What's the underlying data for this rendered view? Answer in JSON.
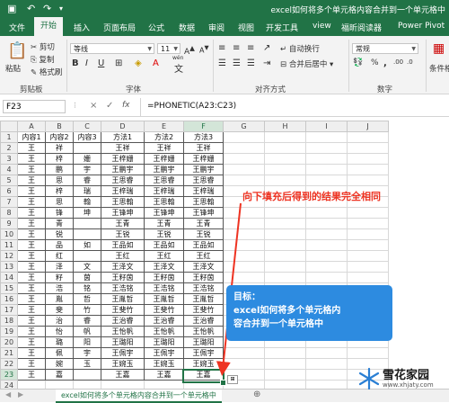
{
  "window": {
    "title": "excel如何将多个单元格内容合并到一个单元格中",
    "autosave_icon": "save-icon",
    "undo_icon": "undo-icon",
    "redo_icon": "redo-icon"
  },
  "tabs": [
    "文件",
    "开始",
    "插入",
    "页面布局",
    "公式",
    "数据",
    "审阅",
    "视图",
    "开发工具",
    "view",
    "福昕阅读器",
    "Power Pivot"
  ],
  "active_tab": "开始",
  "ribbon": {
    "clipboard": {
      "paste": "粘贴",
      "cut": "剪切",
      "copy": "复制",
      "format_painter": "格式刷",
      "group": "剪贴板"
    },
    "font": {
      "name": "等线",
      "size": "11",
      "bold": "B",
      "italic": "I",
      "underline": "U",
      "group": "字体",
      "wen": "wén"
    },
    "alignment": {
      "wrap": "自动换行",
      "merge": "合并后居中",
      "group": "对齐方式"
    },
    "number": {
      "format": "常规",
      "percent": "%",
      "comma": ",",
      "group": "数字"
    },
    "styles": {
      "conditional": "条件格式"
    }
  },
  "formula_bar": {
    "name_box": "F23",
    "cancel": "×",
    "confirm": "✓",
    "fx": "fx",
    "formula": "=PHONETIC(A23:C23)"
  },
  "sheet": {
    "columns": [
      "A",
      "B",
      "C",
      "D",
      "E",
      "F",
      "G",
      "H",
      "I",
      "J"
    ],
    "selected_col": "F",
    "selected_row": 23,
    "rows": [
      [
        "内容1",
        "内容2",
        "内容3",
        "方法1",
        "方法2",
        "方法3"
      ],
      [
        "王",
        "祥",
        "",
        "王祥",
        "王祥",
        "王祥"
      ],
      [
        "王",
        "梓",
        "姗",
        "王梓姗",
        "王梓姗",
        "王梓姗"
      ],
      [
        "王",
        "鹏",
        "宇",
        "王鹏宇",
        "王鹏宇",
        "王鹏宇"
      ],
      [
        "王",
        "思",
        "睿",
        "王思睿",
        "王思睿",
        "王思睿"
      ],
      [
        "王",
        "梓",
        "瑞",
        "王梓瑞",
        "王梓瑞",
        "王梓瑞"
      ],
      [
        "王",
        "思",
        "翰",
        "王思翰",
        "王思翰",
        "王思翰"
      ],
      [
        "王",
        "锋",
        "坤",
        "王锋坤",
        "王锋坤",
        "王锋坤"
      ],
      [
        "王",
        "青",
        "",
        "王青",
        "王青",
        "王青"
      ],
      [
        "王",
        "锐",
        "",
        "王锐",
        "王锐",
        "王锐"
      ],
      [
        "王",
        "品",
        "如",
        "王品如",
        "王品如",
        "王品如"
      ],
      [
        "王",
        "红",
        "",
        "王红",
        "王红",
        "王红"
      ],
      [
        "王",
        "泽",
        "文",
        "王泽文",
        "王泽文",
        "王泽文"
      ],
      [
        "王",
        "籽",
        "茵",
        "王籽茵",
        "王籽茵",
        "王籽茵"
      ],
      [
        "王",
        "浩",
        "铭",
        "王浩铭",
        "王浩铭",
        "王浩铭"
      ],
      [
        "王",
        "胤",
        "哲",
        "王胤哲",
        "王胤哲",
        "王胤哲"
      ],
      [
        "王",
        "斐",
        "竹",
        "王斐竹",
        "王斐竹",
        "王斐竹"
      ],
      [
        "王",
        "治",
        "睿",
        "王治睿",
        "王治睿",
        "王治睿"
      ],
      [
        "王",
        "怡",
        "帆",
        "王怡帆",
        "王怡帆",
        "王怡帆"
      ],
      [
        "王",
        "璐",
        "阳",
        "王璐阳",
        "王璐阳",
        "王璐阳"
      ],
      [
        "王",
        "佩",
        "宇",
        "王佩宇",
        "王佩宇",
        "王佩宇"
      ],
      [
        "王",
        "婉",
        "玉",
        "王婉玉",
        "王婉玉",
        "王婉玉"
      ],
      [
        "王",
        "嘉",
        "",
        "王嘉",
        "王嘉",
        "王嘉"
      ]
    ]
  },
  "annotations": {
    "fill_note": "向下填充后得到的结果完全相同",
    "callout_title": "目标：",
    "callout_line1": "excel如何将多个单元格内",
    "callout_line2": "容合并到一个单元格中"
  },
  "sheet_tabs": {
    "current": "excel如何将多个单元格内容合并到一个单元格中",
    "add": "⊕"
  },
  "watermark": {
    "name": "雪花家园",
    "url": "www.xhjaty.com"
  },
  "colors": {
    "excel_green": "#217346",
    "annotation_red": "#ee3322",
    "callout_blue": "#2d8be0"
  }
}
